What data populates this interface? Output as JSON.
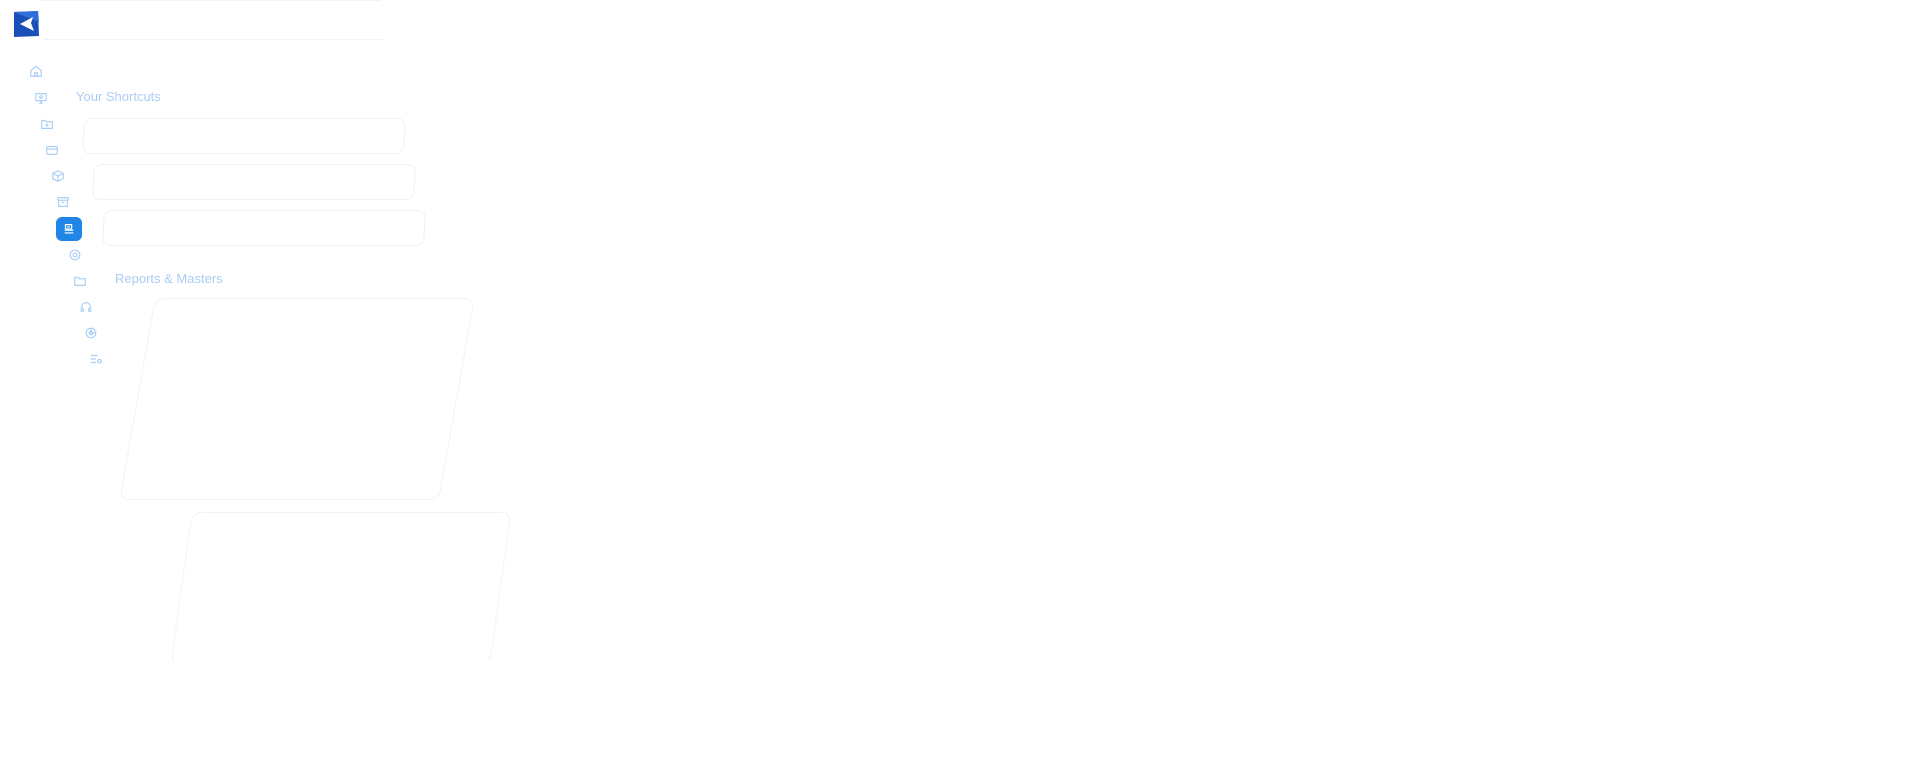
{
  "app": {
    "logo_icon": "app-logo-icon"
  },
  "rail": {
    "items": [
      {
        "id": "home",
        "icon": "home-icon",
        "active": false
      },
      {
        "id": "dashboard",
        "icon": "monitor-icon",
        "active": false
      },
      {
        "id": "import",
        "icon": "folder-plus-icon",
        "active": false
      },
      {
        "id": "cards",
        "icon": "credit-card-icon",
        "active": false
      },
      {
        "id": "products",
        "icon": "box-icon",
        "active": false
      },
      {
        "id": "inventory",
        "icon": "archive-icon",
        "active": false
      },
      {
        "id": "ledger",
        "icon": "stack-icon",
        "active": true
      },
      {
        "id": "settings",
        "icon": "gear-icon",
        "active": false
      },
      {
        "id": "files",
        "icon": "folder-icon",
        "active": false
      },
      {
        "id": "support",
        "icon": "headset-icon",
        "active": false
      },
      {
        "id": "analytics",
        "icon": "pie-chart-icon",
        "active": false
      },
      {
        "id": "config",
        "icon": "list-settings-icon",
        "active": false
      }
    ],
    "accent_color": "#1f86e8",
    "icon_color": "#a9cdf4"
  },
  "main": {
    "shortcuts_title": "Your Shortcuts",
    "reports_title": "Reports & Masters"
  }
}
